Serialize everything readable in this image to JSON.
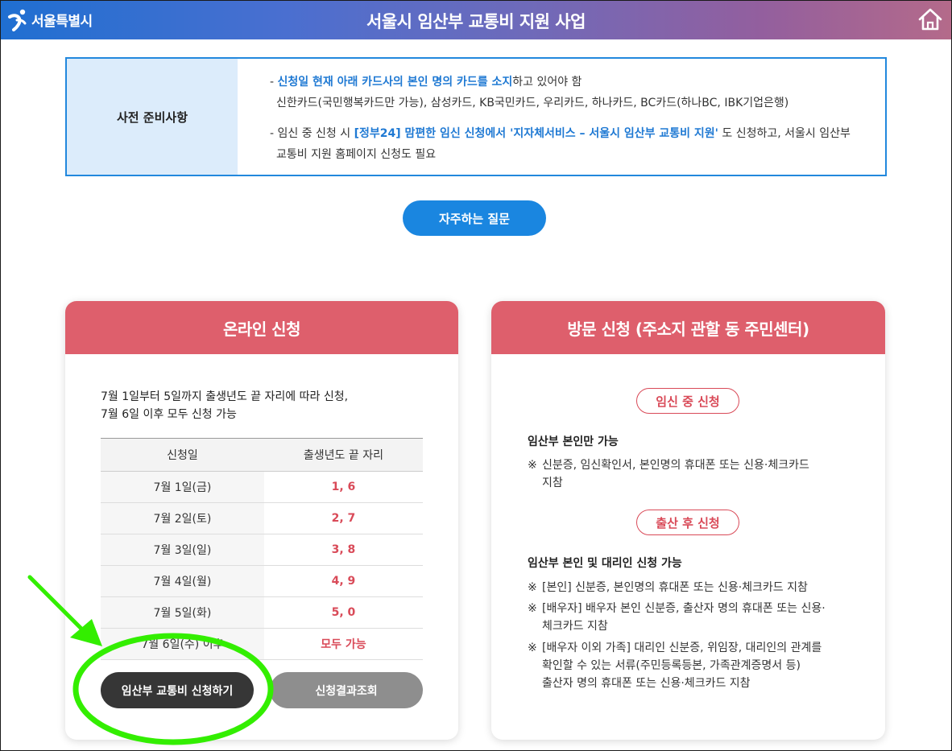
{
  "header": {
    "logo_text": "서울특별시",
    "title": "서울시 임산부 교통비 지원 사업",
    "home_icon": "home-icon"
  },
  "prep": {
    "label": "사전 준비사항",
    "item1_dash": "- ",
    "item1_highlight": "신청일 현재 아래 카드사의 본인 명의 카드를 소지",
    "item1_rest": "하고 있어야 함",
    "item1_cards": "신한카드(국민행복카드만 가능), 삼성카드, KB국민카드, 우리카드, 하나카드, BC카드(하나BC, IBK기업은행)",
    "item2_dash": "- ",
    "item2_pre": "임신 중 신청 시 ",
    "item2_highlight": "[정부24] 맘편한 임신 신청에서 '지자체서비스 – 서울시 임산부 교통비 지원'",
    "item2_rest": " 도 신청하고, 서울시 임산부",
    "item2_line2": "교통비 지원 홈페이지 신청도 필요"
  },
  "faq_button": "자주하는 질문",
  "online": {
    "title": "온라인 신청",
    "desc_line1": "7월 1일부터 5일까지 출생년도 끝 자리에 따라 신청,",
    "desc_line2": "7월 6일 이후 모두 신청 가능",
    "table_headers": [
      "신청일",
      "출생년도 끝 자리"
    ],
    "rows": [
      {
        "date": "7월 1일(금)",
        "digits": "1, 6"
      },
      {
        "date": "7월 2일(토)",
        "digits": "2, 7"
      },
      {
        "date": "7월 3일(일)",
        "digits": "3, 8"
      },
      {
        "date": "7월 4일(월)",
        "digits": "4, 9"
      },
      {
        "date": "7월 5일(화)",
        "digits": "5, 0"
      },
      {
        "date": "7월 6일(수) 이후",
        "digits": "모두 가능"
      }
    ],
    "apply_button": "임산부 교통비 신청하기",
    "result_button": "신청결과조회"
  },
  "visit": {
    "title": "방문 신청 (주소지 관할 동 주민센터)",
    "pregnant_pill": "임신 중 신청",
    "pregnant_subtitle": "임산부 본인만 가능",
    "pregnant_note_mark": "※",
    "pregnant_note_line1": "신분증, 임신확인서, 본인명의 휴대폰 또는 신용·체크카드",
    "pregnant_note_line2": "지참",
    "postbirth_pill": "출산 후 신청",
    "postbirth_subtitle": "임산부 본인 및 대리인 신청 가능",
    "notes": [
      {
        "mark": "※",
        "line1": "[본인] 신분증, 본인명의 휴대폰 또는 신용·체크카드 지참"
      },
      {
        "mark": "※",
        "line1": "[배우자] 배우자 본인 신분증, 출산자 명의 휴대폰 또는 신용·",
        "line2": "체크카드 지참"
      },
      {
        "mark": "※",
        "line1": "[배우자 이외 가족] 대리인 신분증, 위임장, 대리인의 관계를",
        "line2": "확인할 수 있는 서류(주민등록등본, 가족관계증명서 등)",
        "line3": "출산자 명의 휴대폰 또는 신용·체크카드 지참"
      }
    ]
  },
  "annotation": {
    "color": "#33ee00"
  }
}
